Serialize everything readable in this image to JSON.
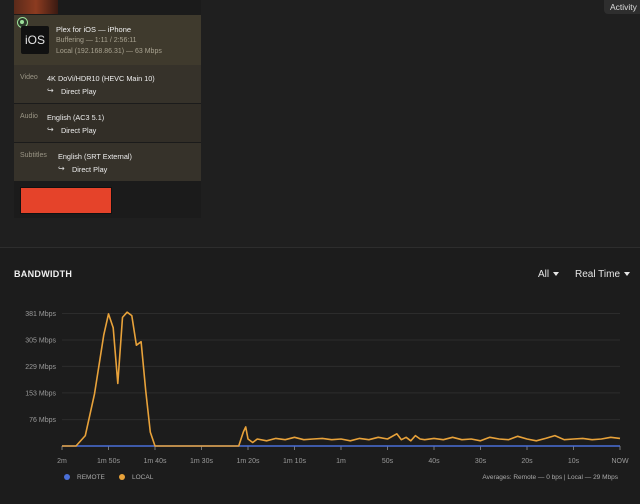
{
  "activity_tab": {
    "label": "Activity"
  },
  "session": {
    "player": "Plex for iOS",
    "device": "iPhone",
    "badge": "iOS",
    "status": "Buffering",
    "progress": "1:11 / 2:56:11",
    "network": "Local (192.168.86.31)",
    "bitrate": "63 Mbps",
    "video": {
      "label": "Video",
      "value": "4K DoVi/HDR10 (HEVC Main 10)",
      "arrow": "↪",
      "mode": "Direct Play"
    },
    "audio": {
      "label": "Audio",
      "value": "English (AC3 5.1)",
      "arrow": "↪",
      "mode": "Direct Play"
    },
    "subtitles": {
      "label": "Subtitles",
      "value": "English (SRT External)",
      "arrow": "↪",
      "mode": "Direct Play"
    }
  },
  "bandwidth": {
    "title": "BANDWIDTH",
    "filter": "All",
    "range": "Real Time",
    "remote_label": "REMOTE",
    "local_label": "LOCAL",
    "averages": "Averages: Remote — 0 bps | Local — 29 Mbps",
    "colors": {
      "remote": "#4a6fd8",
      "local": "#e8a23a"
    }
  },
  "chart_data": {
    "type": "line",
    "x": [
      "2m",
      "1m 50s",
      "1m 40s",
      "1m 30s",
      "1m 20s",
      "1m 10s",
      "1m",
      "50s",
      "40s",
      "30s",
      "20s",
      "10s",
      "NOW"
    ],
    "y_ticks": [
      "381 Mbps",
      "305 Mbps",
      "229 Mbps",
      "153 Mbps",
      "76 Mbps"
    ],
    "ylim": [
      0,
      420
    ],
    "series": [
      {
        "name": "REMOTE",
        "color": "#4a6fd8",
        "values": [
          [
            120,
            0
          ],
          [
            0,
            0
          ]
        ]
      },
      {
        "name": "LOCAL",
        "color": "#e8a23a",
        "values": [
          [
            120,
            0
          ],
          [
            117,
            0
          ],
          [
            115,
            30
          ],
          [
            113,
            150
          ],
          [
            111,
            320
          ],
          [
            110,
            380
          ],
          [
            109,
            340
          ],
          [
            108,
            180
          ],
          [
            107,
            370
          ],
          [
            106,
            385
          ],
          [
            105,
            375
          ],
          [
            104,
            290
          ],
          [
            103,
            300
          ],
          [
            102,
            160
          ],
          [
            101,
            40
          ],
          [
            100,
            0
          ],
          [
            82,
            0
          ],
          [
            81,
            40
          ],
          [
            80.5,
            55
          ],
          [
            80,
            20
          ],
          [
            79,
            10
          ],
          [
            78,
            20
          ],
          [
            76,
            15
          ],
          [
            74,
            22
          ],
          [
            72,
            18
          ],
          [
            70,
            25
          ],
          [
            68,
            18
          ],
          [
            66,
            20
          ],
          [
            64,
            22
          ],
          [
            62,
            18
          ],
          [
            60,
            20
          ],
          [
            58,
            15
          ],
          [
            56,
            22
          ],
          [
            54,
            18
          ],
          [
            52,
            25
          ],
          [
            50,
            20
          ],
          [
            48,
            35
          ],
          [
            47,
            18
          ],
          [
            46,
            25
          ],
          [
            45,
            15
          ],
          [
            44,
            30
          ],
          [
            43,
            20
          ],
          [
            42,
            18
          ],
          [
            40,
            22
          ],
          [
            38,
            18
          ],
          [
            36,
            25
          ],
          [
            34,
            18
          ],
          [
            32,
            20
          ],
          [
            30,
            15
          ],
          [
            28,
            25
          ],
          [
            26,
            20
          ],
          [
            24,
            18
          ],
          [
            22,
            28
          ],
          [
            20,
            20
          ],
          [
            18,
            15
          ],
          [
            16,
            22
          ],
          [
            14,
            30
          ],
          [
            12,
            18
          ],
          [
            10,
            20
          ],
          [
            8,
            22
          ],
          [
            6,
            18
          ],
          [
            4,
            20
          ],
          [
            2,
            25
          ],
          [
            0,
            22
          ]
        ]
      }
    ]
  }
}
